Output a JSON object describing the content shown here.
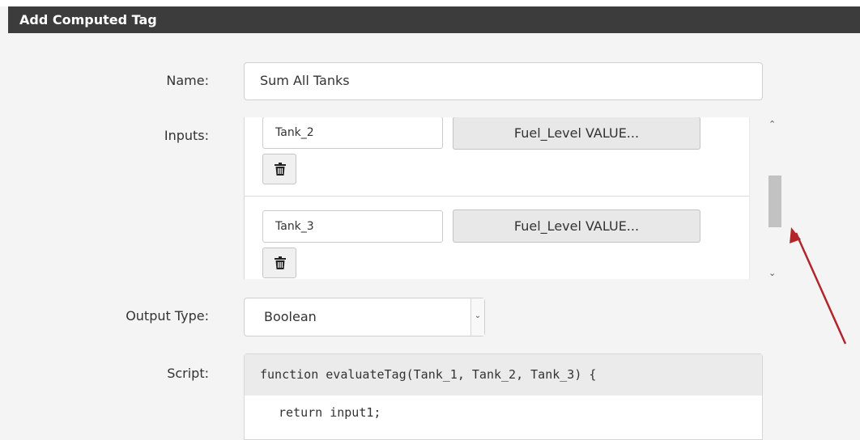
{
  "dialog": {
    "title": "Add Computed Tag"
  },
  "form": {
    "name_label": "Name:",
    "name_value": "Sum All Tanks",
    "inputs_label": "Inputs:",
    "inputs": [
      {
        "variable": "Tank_2",
        "tag_button": "Fuel_Level VALUE..."
      },
      {
        "variable": "Tank_3",
        "tag_button": "Fuel_Level VALUE..."
      }
    ],
    "output_type_label": "Output Type:",
    "output_type_value": "Boolean",
    "script_label": "Script:",
    "script_signature": "function evaluateTag(Tank_1, Tank_2, Tank_3) {",
    "script_body": "return input1;"
  },
  "icons": {
    "delete": "trash-icon",
    "scroll_up": "chevron-up-icon",
    "scroll_down": "chevron-down-icon",
    "select": "chevron-down-icon"
  },
  "colors": {
    "title_bar": "#3c3c3c",
    "annotation_arrow": "#b0262b"
  }
}
